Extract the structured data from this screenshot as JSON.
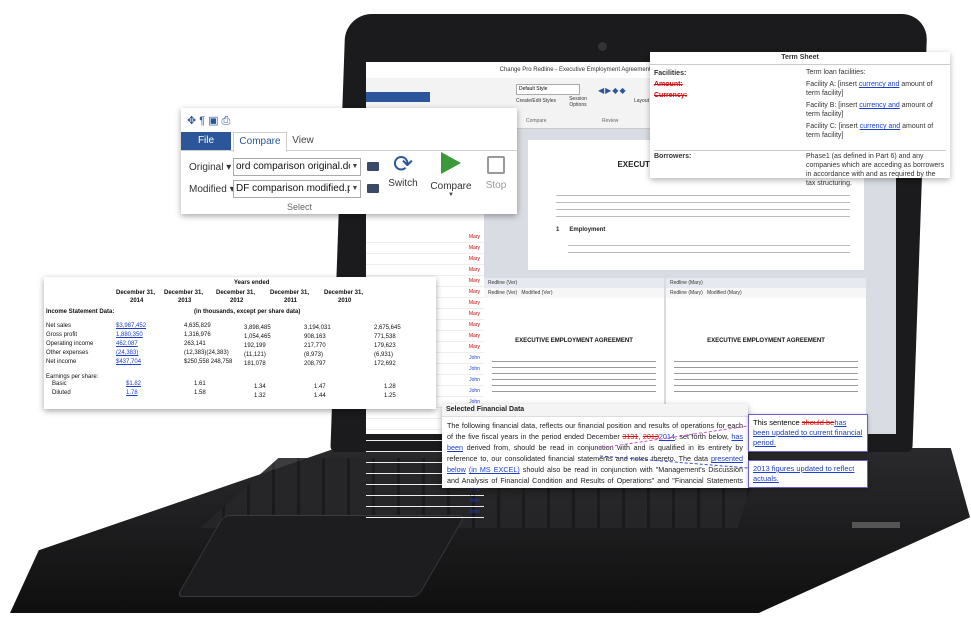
{
  "app": {
    "title": "Change Pro Redline - Executive Employment Agreement and Executive Employment Agreement M",
    "tabs_small": [
      "File",
      "Compare",
      "View"
    ],
    "default_style": "Default Style",
    "create_edit_styles": "Create/Edit Styles",
    "session_options": "Session Options",
    "compare_group": "Compare",
    "review_group": "Review",
    "layout": "Layout"
  },
  "ribbon": {
    "tabs": [
      "File",
      "Compare",
      "View"
    ],
    "original_label": "Original",
    "original_value": "ord comparison original.docx",
    "modified_label": "Modified",
    "modified_value": "DF comparison modified.pdf",
    "switch_label": "Switch",
    "compare_label": "Compare",
    "stop_label": "Stop",
    "group_label": "Select"
  },
  "document": {
    "title": "EXECUTIVE EMPLOYMENT AGREEMENT",
    "section_num": "1",
    "section_title": "Employment",
    "pane_left_header": "Redline (Ver)",
    "pane_left_tabs": [
      "Redline (Ver)",
      "Modified (Ver)"
    ],
    "pane_right_header": "Redline (Mary)",
    "pane_right_tabs": [
      "Redline (Mary)",
      "Modified (Mary)"
    ],
    "list_names": [
      "Mary",
      "Mary",
      "Mary",
      "Mary",
      "Mary",
      "Mary",
      "Mary",
      "Mary",
      "Mary",
      "Mary",
      "Mary",
      "John",
      "John",
      "John",
      "John",
      "John",
      "John",
      "John",
      "John",
      "John",
      "John",
      "John",
      "John",
      "John",
      "John",
      "John"
    ]
  },
  "term_sheet": {
    "title": "Term Sheet",
    "facilities_label": "Facilities:",
    "amount_label": "Amount:",
    "currency_label": "Currency:",
    "facilities_value": "Term loan facilities:",
    "facility_a_pre": "Facility A: [insert ",
    "facility_b_pre": "Facility B: [insert ",
    "facility_c_pre": "Facility C: [insert ",
    "facility_ins": "currency and",
    "facility_post": " amount of term facility]",
    "borrowers_label": "Borrowers:",
    "borrowers_value": "Phase1 (as defined in Part 6) and any companies which are acceding as borrowers in accordance with and as required by the tax structuring."
  },
  "spreadsheet": {
    "years_ended": "Years ended",
    "dates": [
      "December 31,",
      "December 31,",
      "December 31,",
      "December 31,",
      "December 31,"
    ],
    "years": [
      "2014",
      "2013",
      "2012",
      "2011",
      "2010"
    ],
    "units": "(in thousands, except per share data)",
    "section": "Income Statement Data:",
    "rows": [
      {
        "label": "Net sales",
        "values": [
          "$3,987,452",
          "4,635,829",
          "3,898,485",
          "3,194,031",
          "2,675,645"
        ]
      },
      {
        "label": "Gross profit",
        "values": [
          "1,880,350",
          "1,316,976",
          "1,054,465",
          "908,163",
          "771,538"
        ]
      },
      {
        "label": "Operating income",
        "values": [
          "462,087",
          "263,141",
          "192,199",
          "217,770",
          "179,623"
        ]
      },
      {
        "label": "Other expenses",
        "values": [
          "(24,383)",
          "(12,383)(24,383)",
          "(11,121)",
          "(8,973)",
          "(6,931)"
        ]
      },
      {
        "label": "Net income",
        "values": [
          "$437,704",
          "$250,558 248,758",
          "181,078",
          "208,797",
          "172,692"
        ]
      }
    ],
    "eps_label": "Earnings per share:",
    "basic_label": "Basic",
    "diluted_label": "Diluted",
    "basic_values": [
      "$1.82",
      "1.61",
      "1.34",
      "1.47",
      "1.28"
    ],
    "diluted_values": [
      "1.78",
      "1.58",
      "1.32",
      "1.44",
      "1.25"
    ]
  },
  "financial": {
    "header": "Selected Financial Data",
    "p1": "The following financial data, reflects our financial position and results of operations for each of the five fiscal years in the period ended December ",
    "del1": "3131",
    "p2": ", ",
    "del2": "2013",
    "ins1": "2014",
    "p3": ", set forth below, ",
    "ins2": "has been",
    "p4": " derived from, should be read in conjunction with and is qualified in its entirety by reference to, our consolidated financial statements and notes thereto.  The data ",
    "ins3": "presented below",
    "p5": " ",
    "ins4": "(in MS EXCEL)",
    "p6": " should also be read in conjunction with \"Management's Discussion and Analysis of Financial Condition and Results of Operations\" and \"Financial Statements and Supplementary Data.\""
  },
  "comments": {
    "c1_pre": "This sentence ",
    "c1_del": "should be",
    "c1_ins": "has been updated to current financial period.",
    "c2": "2013 figures updated to reflect actuals."
  },
  "colors": {
    "accent": "#2b579a",
    "deleted": "#d01010",
    "inserted": "#1a3fd0",
    "compare_green": "#3a9a3a"
  }
}
